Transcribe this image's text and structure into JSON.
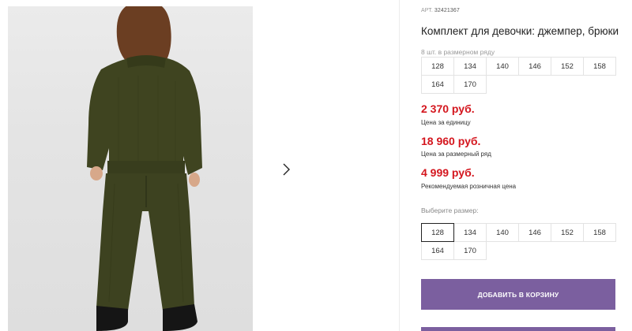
{
  "product": {
    "article_prefix": "АРТ.",
    "article_number": "32421367",
    "title": "Комплект для девочки: джемпер, брюки",
    "row_note": "8 шт. в размерном ряду",
    "row_sizes": [
      "128",
      "134",
      "140",
      "146",
      "152",
      "158",
      "164",
      "170"
    ]
  },
  "prices": [
    {
      "value": "2 370 руб.",
      "label": "Цена за единицу"
    },
    {
      "value": "18 960 руб.",
      "label": "Цена за размерный ряд"
    },
    {
      "value": "4 999 руб.",
      "label": "Рекомендуемая розничная цена"
    }
  ],
  "size_picker": {
    "label": "Выберите размер:",
    "sizes": [
      "128",
      "134",
      "140",
      "146",
      "152",
      "158",
      "164",
      "170"
    ],
    "selected": "128"
  },
  "cart": {
    "label": "ДОБАВИТЬ В КОРЗИНУ"
  },
  "icons": {
    "next": "chevron-right-icon"
  },
  "colors": {
    "price": "#d4161e",
    "button": "#7b5f9f",
    "garment": "#3f4420"
  }
}
